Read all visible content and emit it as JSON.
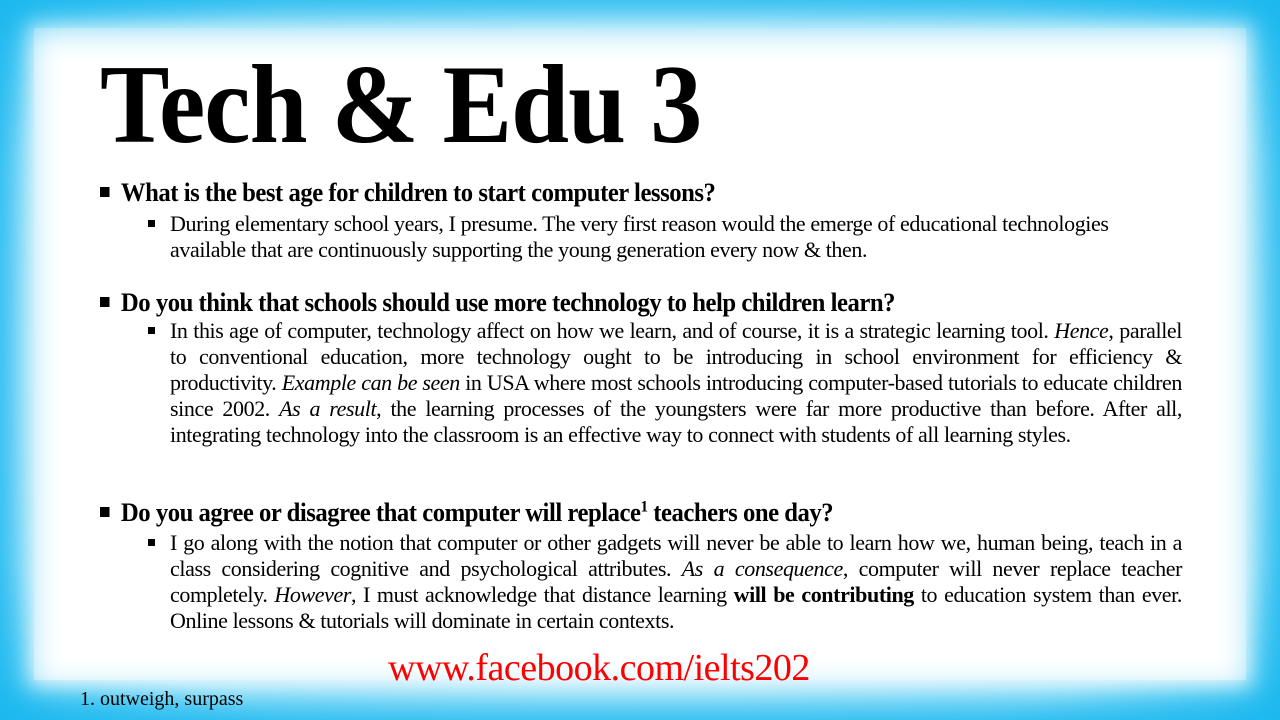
{
  "slide": {
    "title": "Tech & Edu 3",
    "q1": {
      "question": "What is the best age for children to start computer lessons?",
      "answer": [
        "During elementary school years, I presume. The very first reason would the emerge of educational technologies available that are continuously supporting the young generation every now & then."
      ]
    },
    "q2": {
      "question": "Do you think that schools should use more technology to help children learn?",
      "answer": [
        "In this age of computer, technology affect on how we learn, and of course, it is a strategic learning tool. ",
        "Hence",
        ", parallel to conventional education, more technology ought to be introducing in school environment for efficiency & productivity. ",
        "Example can be seen",
        " in USA where most schools introducing computer-based tutorials to educate children since 2002. ",
        "As a result",
        ", the learning processes of the youngsters were far more productive than before. After all, integrating technology into the classroom is an effective way to connect with students of all learning styles."
      ]
    },
    "q3": {
      "question_before": "Do you agree or disagree that computer will replace",
      "footnote_mark": "1",
      "question_after": " teachers one day?",
      "answer": [
        "I go along with the notion that computer or other gadgets will never be able to learn how we, human being, teach in a class considering cognitive and psychological attributes. ",
        "As a consequence",
        ", computer will never replace teacher completely. ",
        "However",
        ", I must acknowledge that distance learning ",
        "will be contributing",
        " to education system than ever. Online lessons & tutorials will dominate in certain contexts."
      ]
    },
    "watermark": "www.facebook.com/ielts202",
    "footnote": "1. outweigh, surpass",
    "colors": {
      "frame": "#1cb8ef",
      "watermark": "#ff0000"
    }
  }
}
